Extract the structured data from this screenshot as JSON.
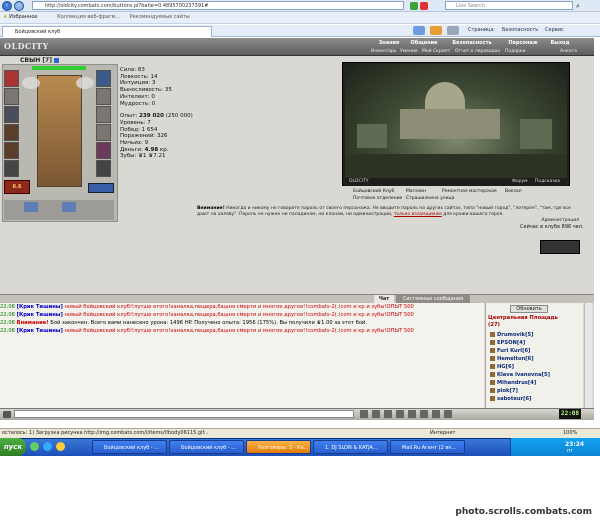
{
  "browser": {
    "address": "http://oldcity.combats.com/buttons.pl?batle=0.4895700237391#",
    "search_placeholder": "Live Search",
    "favorites_label": "Избранное",
    "fav_links": [
      "Коллекция веб-фрагм...",
      "Рекомендуемые сайты"
    ],
    "tab_title": "Бойцовский клуб",
    "cmd_page": "Страница",
    "cmd_safety": "Безопасность",
    "cmd_service": "Сервис"
  },
  "game": {
    "logo": "OLDCITY",
    "top_menu": [
      "Знания",
      "Общение",
      "Безопасность",
      "Персонаж",
      "Выход"
    ],
    "sub_menu": [
      "Инвентарь",
      "Умения",
      "Мой Скрипт",
      "Отчет о переводах",
      "Подарки",
      "Анкета"
    ],
    "character": {
      "name": "СВЫН",
      "level": "[7]",
      "stats": {
        "strength": "Сила: 83",
        "agility": "Ловкость: 14",
        "intuition": "Интуиция: 3",
        "endurance": "Выносливость: 35",
        "intellect": "Интелект: 0",
        "wisdom": "Мудрость: 0"
      },
      "progress": {
        "exp_label": "Опыт:",
        "exp": "239 020",
        "exp_next": "(250 000)",
        "level": "Уровень: 7",
        "wins": "Побед: 1 654",
        "losses": "Поражений: 326",
        "draws": "Ничьих: 9",
        "money_label": "Деньги:",
        "money": "4.98",
        "money_unit": "кр.",
        "teeth": "Зубы: ♛1 ♛7.21"
      },
      "hp_bar_fraction": 1.0
    },
    "location": {
      "name": "OLDCITY",
      "scene_links": [
        "Форум",
        "Подсказка"
      ],
      "links_col1": [
        "Бойцовский Клуб",
        "Почтовое отделение"
      ],
      "links_col2": [
        "Магазин",
        "Страшилкина улица"
      ],
      "links_col3": [
        "Ремонтная мастерская"
      ],
      "links_col4": [
        "Вокзал"
      ]
    },
    "warning": {
      "head": "Внимание!",
      "text": "Никогда и никому не говорите пароль от своего персонажа. Не вводите пароль на других сайтах, типа \"новый город\", \"лотерея\", \"там, где все дают на халяву\". Пароль не нужен ни паладинам, ни кланам, ни администрации,",
      "link": "только взломщикам",
      "tail": "для кражи вашего героя.",
      "sign": "Администрация"
    },
    "online_text": "Сейчас в клубе 896 чел.",
    "chat_tabs": [
      "Чат",
      "Системные сообщения"
    ],
    "chat_lines": [
      {
        "time": "22:08",
        "nick": "[Крик Тишины]",
        "text": "новый бойцовский клуб!!лутше етого!каналка,пещера,башня смерти и многое другое!!combats-2(.)com и кр и зубы!ОПЫТ 500"
      },
      {
        "time": "22:08",
        "nick": "[Крик Тишины]",
        "text": "новый бойцовский клуб!!лутше етого!каналка,пещера,башня смерти и многое другое!!combats-2(.)com и кр и зубы!ОПЫТ 500"
      },
      {
        "time": "22:08",
        "nick": "Внимание!",
        "text": "Бой закончен. Всего вами нанесено урона: 1496 HP. Получено опыта: 1956 (175%). Вы получили ♛1.00 за этот бой."
      },
      {
        "time": "22:08",
        "nick": "[Крик Тишины]",
        "text": "новый бойцовский клуб!!лутше етого!каналка,пещера,башня смерти и многое другое!!combats-2(.)com и кр и зубы!ОПЫТ 500"
      }
    ],
    "online_panel": {
      "refresh": "Обновить",
      "room": "Центральная Площадь",
      "count": "(27)",
      "players": [
        "Drumovik[5]",
        "EPSON[4]",
        "Furi Kuri[6]",
        "Hemelton[6]",
        "HG[6]",
        "Klava Ivanovna[5]",
        "Mihandrus[4]",
        "plok[7]",
        "saboteur[6]"
      ]
    },
    "clock": "22:08"
  },
  "status": {
    "text": "осталось: 1) Загрузка рисунка http://img.combats.com/i/items/f/body06115.gif...",
    "zone": "Интернет",
    "zoom": "100%"
  },
  "taskbar": {
    "start": "пуск",
    "tasks": [
      "Бойцовский клуб - ...",
      "Бойцовский клуб - ...",
      "Разговоры: 3 - Ка...",
      "1. DJ SLON & KATJA...",
      "Mail.Ru Агент (2 вк..."
    ],
    "time": "23:24",
    "day": "пт"
  },
  "watermark": "photo.scrolls.combats.com",
  "colors": {
    "nick": "#0000cc",
    "alert": "#cc0000",
    "time": "#007700",
    "text": "#cc0000"
  }
}
